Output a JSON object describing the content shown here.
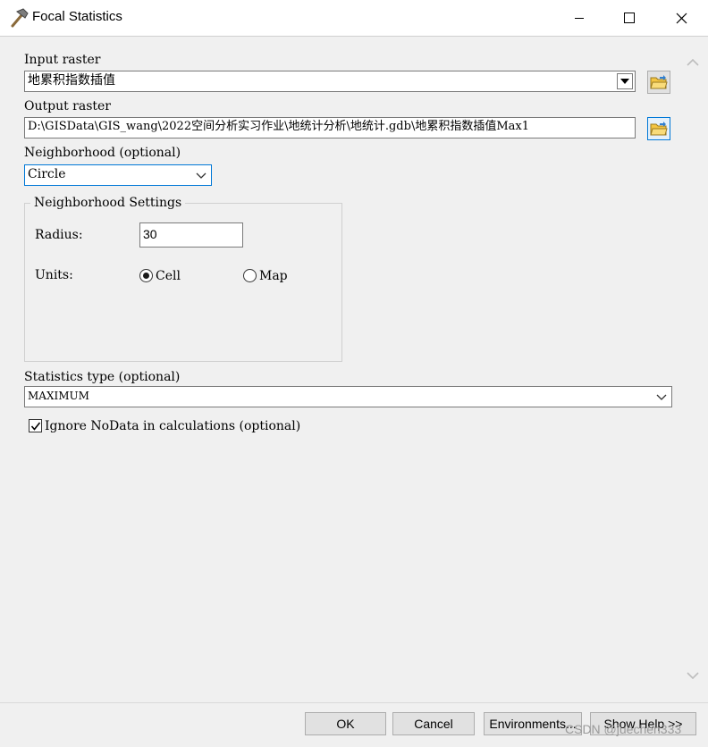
{
  "window": {
    "title": "Focal Statistics",
    "controls": {
      "minimize": "minimize",
      "maximize": "maximize",
      "close": "close"
    }
  },
  "form": {
    "input_raster": {
      "label": "Input raster",
      "value": "地累积指数插值"
    },
    "output_raster": {
      "label": "Output raster",
      "value": "D:\\GISData\\GIS_wang\\2022空间分析实习作业\\地统计分析\\地统计.gdb\\地累积指数插值Max1"
    },
    "neighborhood": {
      "label": "Neighborhood (optional)",
      "value": "Circle"
    },
    "neighborhood_settings": {
      "legend": "Neighborhood Settings",
      "radius_label": "Radius:",
      "radius_value": "30",
      "units_label": "Units:",
      "units_options": [
        {
          "label": "Cell",
          "selected": true
        },
        {
          "label": "Map",
          "selected": false
        }
      ]
    },
    "statistics_type": {
      "label": "Statistics type (optional)",
      "value": "MAXIMUM"
    },
    "ignore_nodata": {
      "label": "Ignore NoData in calculations (optional)",
      "checked": true
    }
  },
  "buttons": {
    "ok": "OK",
    "cancel": "Cancel",
    "environments": "Environments...",
    "show_help": "Show Help >>"
  },
  "watermark": "CSDN @juechen333",
  "colors": {
    "focus_border": "#0078d7",
    "folder_yellow": "#f4c542",
    "dialog_bg": "#f0f0f0"
  }
}
